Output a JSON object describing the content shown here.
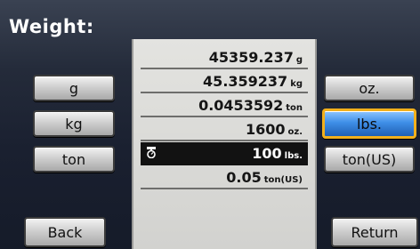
{
  "header": {
    "title": "Weight:"
  },
  "left_units": [
    "g",
    "kg",
    "ton"
  ],
  "right_units": [
    "oz.",
    "lbs.",
    "ton(US)"
  ],
  "rows": [
    {
      "value": "45359.237",
      "unit": "g"
    },
    {
      "value": "45.359237",
      "unit": "kg"
    },
    {
      "value": "0.0453592",
      "unit": "ton"
    },
    {
      "value": "1600",
      "unit": "oz."
    },
    {
      "value": "100",
      "unit": "lbs."
    },
    {
      "value": "0.05",
      "unit": "ton(US)"
    }
  ],
  "selected_row": 4,
  "active_unit": "lbs.",
  "footer": {
    "back_label": "Back",
    "return_label": "Return"
  },
  "colors": {
    "active_fill": "#3f8fe8",
    "active_border": "#f2b01c"
  },
  "icons": {
    "selected_row_icon": "scale-icon"
  }
}
